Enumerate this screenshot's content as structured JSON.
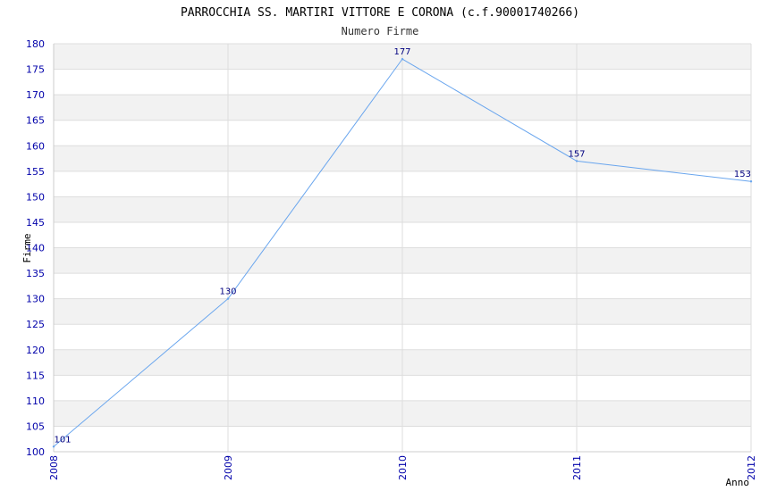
{
  "chart_data": {
    "type": "line",
    "title": "PARROCCHIA SS. MARTIRI VITTORE E CORONA (c.f.90001740266)",
    "subtitle": "Numero Firme",
    "xlabel": "Anno",
    "ylabel": "Firme",
    "categories": [
      "2008",
      "2009",
      "2010",
      "2011",
      "2012"
    ],
    "series": [
      {
        "values": [
          101,
          130,
          177,
          157,
          153
        ]
      }
    ],
    "ylim": [
      100,
      180
    ],
    "ytick_step": 5,
    "grid": true,
    "colors": {
      "line": "#6aa6ee",
      "band": "#f2f2f2",
      "gridline": "#dddddd",
      "tick_text": "#0000aa",
      "data_label": "#000080"
    }
  }
}
